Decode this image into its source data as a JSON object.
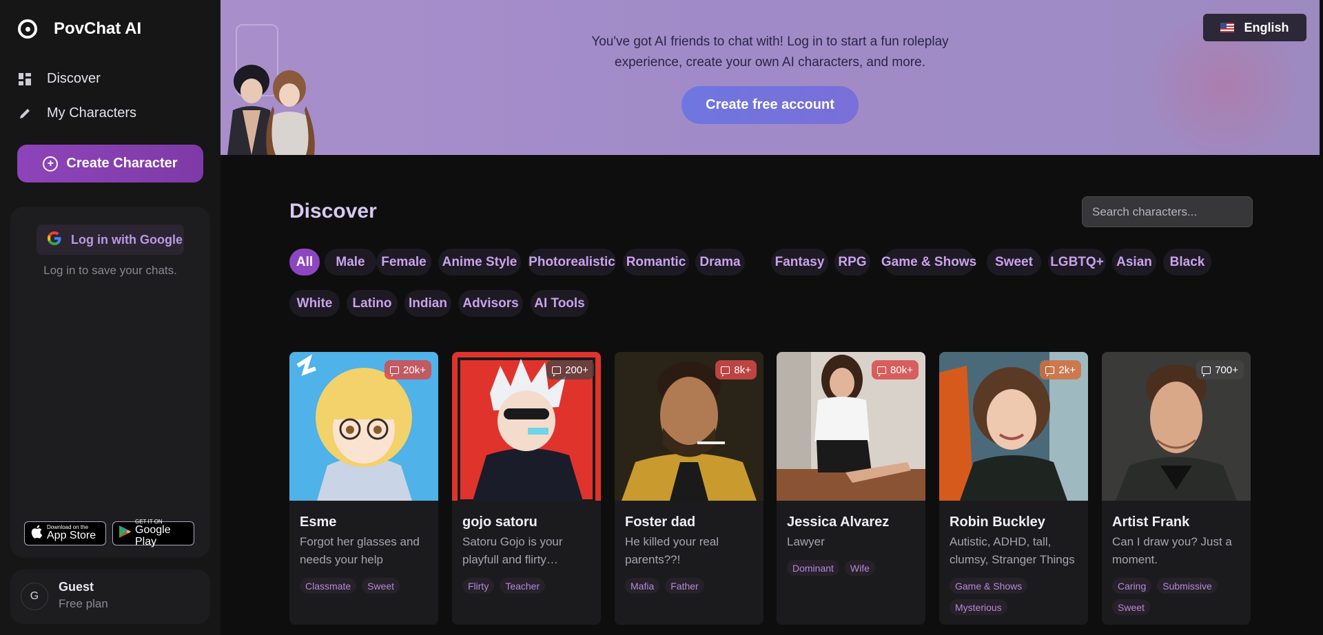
{
  "sidebar": {
    "brand": "PovChat AI",
    "nav": [
      {
        "label": "Discover",
        "icon": "grid-icon"
      },
      {
        "label": "My Characters",
        "icon": "pencil-icon"
      }
    ],
    "create_label": "Create Character",
    "login": {
      "google_label": "Log in with Google",
      "hint": "Log in to save your chats."
    },
    "stores": {
      "apple": {
        "small": "Download on the",
        "big": "App Store"
      },
      "google": {
        "small": "GET IT ON",
        "big": "Google Play"
      }
    },
    "user": {
      "initial": "G",
      "name": "Guest",
      "plan": "Free plan"
    }
  },
  "banner": {
    "line1": "You've got AI friends to chat with! Log in to start a fun roleplay",
    "line2": "experience, create your own AI characters, and more.",
    "cta": "Create free account",
    "language": "English"
  },
  "main": {
    "title": "Discover",
    "search_placeholder": "Search characters...",
    "categories": [
      "All",
      "Male",
      "Female",
      "Anime Style",
      "Photorealistic",
      "Romantic",
      "Drama",
      "Fantasy",
      "RPG",
      "Game & Shows",
      "Sweet",
      "LGBTQ+",
      "Asian",
      "Black",
      "White",
      "Latino",
      "Indian",
      "Advisors",
      "AI Tools"
    ],
    "active_category": "All"
  },
  "cards": [
    {
      "name": "Esme",
      "desc": "Forgot her glasses and needs your help",
      "count": "20k+",
      "tags": [
        "Classmate",
        "Sweet"
      ]
    },
    {
      "name": "gojo satoru",
      "desc": "Satoru Gojo is your playfull and flirty…",
      "count": "200+",
      "tags": [
        "Flirty",
        "Teacher"
      ]
    },
    {
      "name": "Foster dad",
      "desc": "He killed your real parents??!",
      "count": "8k+",
      "tags": [
        "Mafia",
        "Father"
      ]
    },
    {
      "name": "Jessica Alvarez",
      "desc": "Lawyer",
      "count": "80k+",
      "tags": [
        "Dominant",
        "Wife"
      ]
    },
    {
      "name": "Robin Buckley",
      "desc": "Autistic, ADHD, tall, clumsy, Stranger Things",
      "count": "2k+",
      "tags": [
        "Game & Shows",
        "Mysterious"
      ]
    },
    {
      "name": "Artist Frank",
      "desc": "Can I draw you? Just a moment.",
      "count": "700+",
      "tags": [
        "Caring",
        "Submissive",
        "Sweet"
      ]
    }
  ]
}
